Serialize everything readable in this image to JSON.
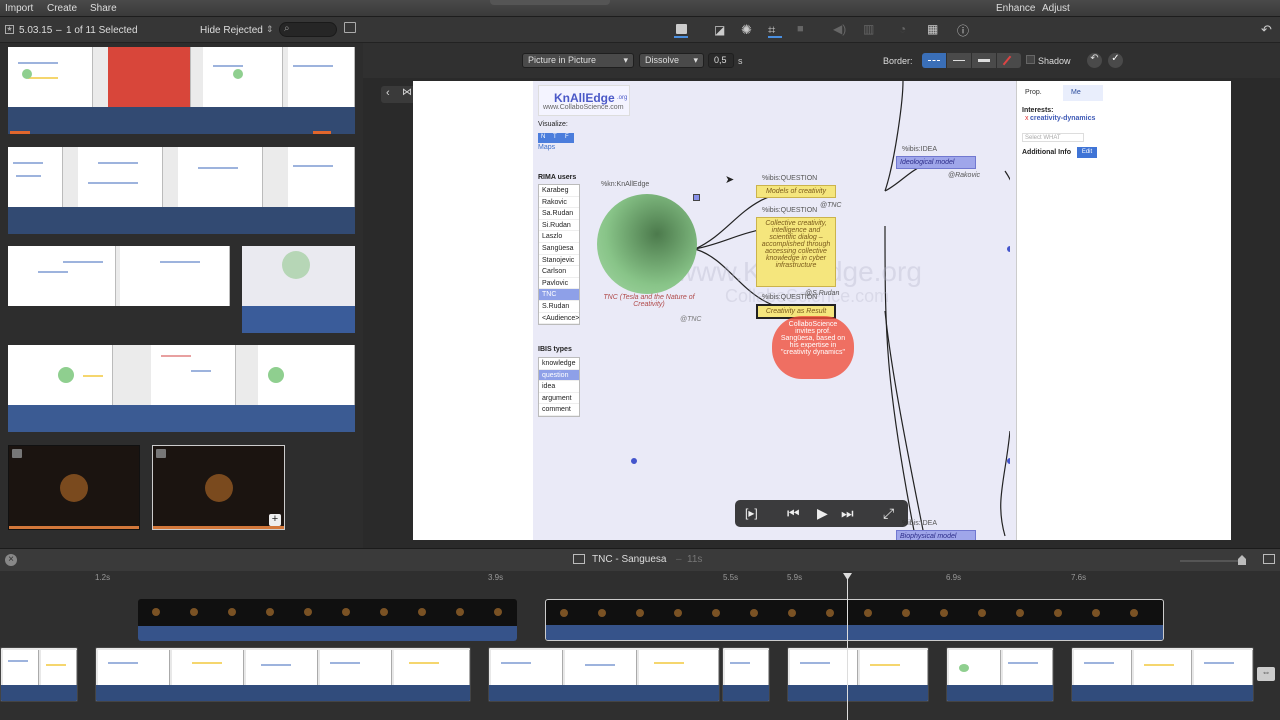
{
  "menu": {
    "import": "Import",
    "create": "Create",
    "share": "Share",
    "enhance": "Enhance",
    "adjust": "Adjust"
  },
  "library": {
    "event": "5.03.15",
    "selection": "1 of 11 Selected",
    "filter": "Hide Rejected"
  },
  "controls": {
    "overlay": "Picture in Picture",
    "transition": "Dissolve",
    "duration": "0,5",
    "duration_unit": "s",
    "border_label": "Border:",
    "shadow_label": "Shadow"
  },
  "mindmap": {
    "logo": "KnAllEdge",
    "logo_suffix": ".org",
    "logo_url": "www.CollaboScience.com",
    "visualize_label": "Visualize:",
    "visualize_buttons": [
      "N",
      "T",
      "F"
    ],
    "visualize_link": "Maps",
    "users_label": "RIMA users",
    "users": [
      "Karabeg",
      "Rakovic",
      "Sa.Rudan",
      "Si.Rudan",
      "Laszlo",
      "Sangüesa",
      "Stanojevic",
      "Carlson",
      "Pavlovic",
      "TNC",
      "S.Rudan",
      "<Audience>"
    ],
    "selected_user": "TNC",
    "ibis_label": "IBIS types",
    "ibis_types": [
      "knowledge",
      "question",
      "idea",
      "argument",
      "comment"
    ],
    "selected_ibis": "question",
    "kn_tag": "%kn:KnAllEdge",
    "center_caption": "TNC (Tesla and the Nature of Creativity)",
    "tnc_author": "@TNC",
    "q1_tag": "%ibis:QUESTION",
    "q1": "Models of creativity",
    "q1_author": "@TNC",
    "q2_tag": "%ibis:QUESTION",
    "q2": "Collective creativity, intelligence and scientific dialog – accomplished through accessing collective knowledge in cyber infrastructure",
    "q2_author": "@S.Rudan",
    "q3_tag": "%ibis:QUESTION",
    "q3": "Creativity as Result",
    "idea1_tag": "%ibis:IDEA",
    "idea1": "Ideological model",
    "idea1_author": "@Rakovic",
    "idea2_tag": "%ibis:IDEA",
    "idea2": "Biophysical model",
    "note": "CollaboScience invites prof. Sangüesa, based on his expertise in \"creativity dynamics\"",
    "watermark": "www.KnAllEdge.org",
    "watermark2": "CollaboScience.com",
    "panel_tab_prop": "Prop.",
    "panel_tab_me": "Me",
    "interests_label": "Interests:",
    "interest": "creativity-dynamics",
    "select_what": "Select WHAT",
    "additional_info": "Additional Info",
    "edit": "Edit"
  },
  "timeline": {
    "title": "TNC - Sanguesa",
    "duration": "11s",
    "ticks": [
      "1.2s",
      "3.9s",
      "5.5s",
      "5.9s",
      "6.9s",
      "7.6s"
    ]
  }
}
